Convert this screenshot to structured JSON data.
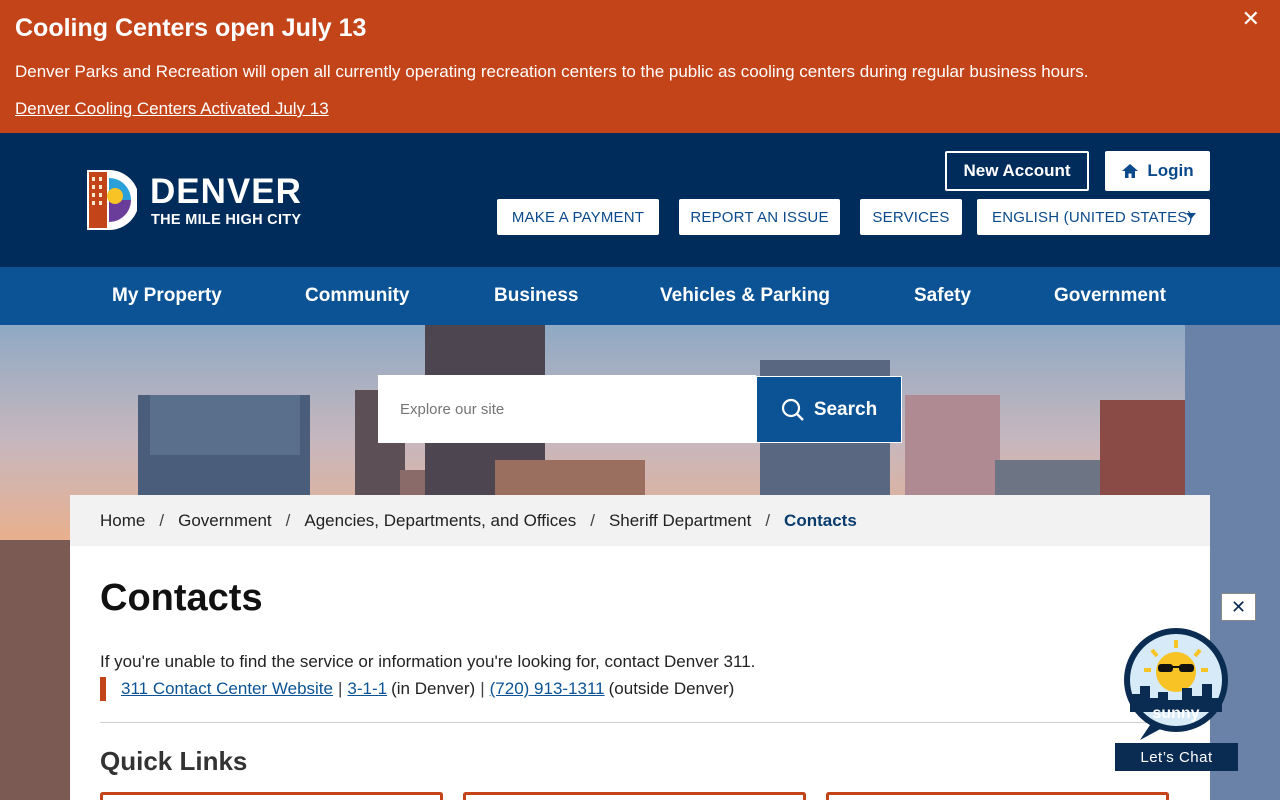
{
  "alert": {
    "title": "Cooling Centers open July 13",
    "body": "Denver Parks and Recreation will open all currently operating recreation centers to the public as cooling centers during regular business hours.",
    "link": "Denver Cooling Centers Activated July 13",
    "close": "✕"
  },
  "header": {
    "logo_word": "DENVER",
    "logo_sub": "THE MILE HIGH CITY",
    "new_account": "New Account",
    "login": "Login",
    "utility": [
      "MAKE A PAYMENT",
      "REPORT AN ISSUE",
      "SERVICES"
    ],
    "language": "ENGLISH (UNITED STATES)"
  },
  "nav": [
    "My Property",
    "Community",
    "Business",
    "Vehicles & Parking",
    "Safety",
    "Government"
  ],
  "search": {
    "placeholder": "Explore our site",
    "button": "Search"
  },
  "breadcrumb": {
    "items": [
      "Home",
      "Government",
      "Agencies, Departments, and Offices",
      "Sheriff Department"
    ],
    "current": "Contacts",
    "sep": "/"
  },
  "page": {
    "title": "Contacts",
    "intro": "If you're unable to find the service or information you're looking for, contact Denver 311.",
    "contact_link": "311 Contact Center Website",
    "phone_short": "3-1-1",
    "in_denver": "(in Denver)",
    "phone_long": "(720) 913-1311",
    "outside": "(outside Denver)",
    "pipe": "|",
    "quick_links": "Quick Links"
  },
  "chat": {
    "name": "sunny",
    "label": "Let’s Chat",
    "close": "✕"
  },
  "colors": {
    "alert": "#c4441a",
    "header": "#002c5c",
    "nav": "#0b5394"
  }
}
